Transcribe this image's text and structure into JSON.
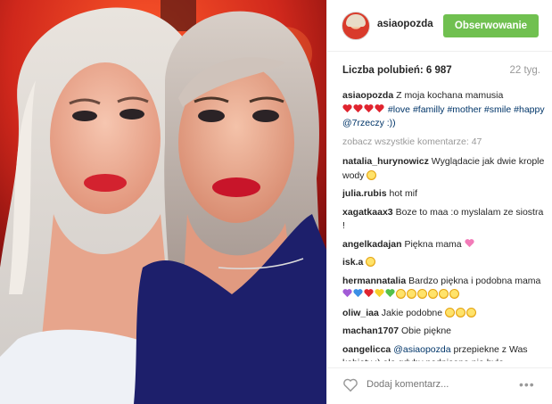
{
  "post": {
    "username": "asiaopozda",
    "follow_label": "Obserwowanie",
    "likes": "Liczba polubień: 6 987",
    "age": "22 tyg."
  },
  "caption": {
    "username": "asiaopozda",
    "text": "Z moja kochana mamusia",
    "hashtags": "#love #familly #mother #smile #happy @7rzeczy :))"
  },
  "view_all": "zobacz wszystkie komentarze: 47",
  "comments": [
    {
      "username": "natalia_hurynowicz",
      "text": "Wyglądacie jak dwie krople wody"
    },
    {
      "username": "julia.rubis",
      "text": "hot mif"
    },
    {
      "username": "xagatkaax3",
      "text": "Boze to maa :o myslalam ze siostra !"
    },
    {
      "username": "angelkadajan",
      "text": "Piękna mama"
    },
    {
      "username": "isk.a",
      "text": ""
    },
    {
      "username": "hermannatalia",
      "text": "Bardzo piękna i podobna mama"
    },
    {
      "username": "oliw_iaa",
      "text": "Jakie podobne"
    },
    {
      "username": "machan1707",
      "text": "Obie piękne"
    },
    {
      "username": "oangelicca",
      "mention": "@asiaopozda",
      "text": "przepiekne z Was kobiety :) ale gdyby podpisane nie bylo myslałabym ze to siostrzyczka, a nie"
    }
  ],
  "footer": {
    "add_comment_placeholder": "Dodaj komentarz...",
    "more_icon": "more-options-icon",
    "like_icon": "heart-outline-icon"
  },
  "colors": {
    "follow_green": "#70c050",
    "hashtag_blue": "#003569",
    "muted": "#999999"
  }
}
